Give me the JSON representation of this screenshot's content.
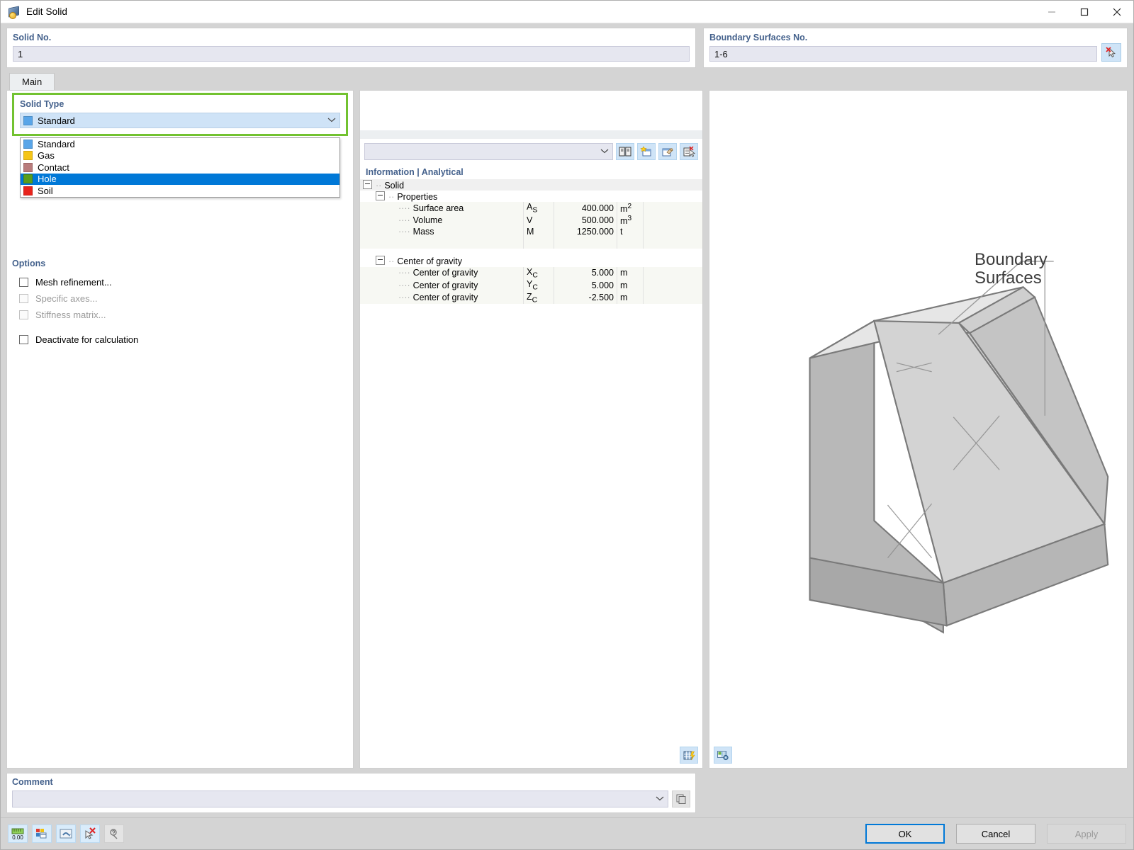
{
  "window": {
    "title": "Edit Solid",
    "icon": "solid-cube-icon",
    "controls": {
      "minimize": "minimize-icon",
      "maximize": "maximize-icon",
      "close": "close-icon"
    }
  },
  "header": {
    "solid_no_label": "Solid No.",
    "solid_no_value": "1",
    "boundary_label": "Boundary Surfaces No.",
    "boundary_value": "1-6",
    "pick_button_icon": "pick-select-icon"
  },
  "tabs": [
    {
      "label": "Main",
      "active": true
    }
  ],
  "solid_type": {
    "group_label": "Solid Type",
    "selected": {
      "label": "Standard",
      "color": "#59a5e8"
    },
    "dropdown_open": true,
    "options": [
      {
        "label": "Standard",
        "color": "#59a5e8",
        "highlighted": false
      },
      {
        "label": "Gas",
        "color": "#f5c518",
        "highlighted": false
      },
      {
        "label": "Contact",
        "color": "#b97c7c",
        "highlighted": false
      },
      {
        "label": "Hole",
        "color": "#5a9e1b",
        "highlighted": true
      },
      {
        "label": "Soil",
        "color": "#e8241c",
        "highlighted": false
      }
    ],
    "highlight_border_color": "#72c230",
    "highlight_row_color": "#0078d7"
  },
  "options": {
    "title": "Options",
    "items": [
      {
        "label": "Mesh refinement...",
        "checked": false,
        "enabled": true
      },
      {
        "label": "Specific axes...",
        "checked": false,
        "enabled": false
      },
      {
        "label": "Stiffness matrix...",
        "checked": false,
        "enabled": false
      },
      {
        "label": "Deactivate for calculation",
        "checked": false,
        "enabled": true
      }
    ]
  },
  "middle": {
    "material_combo_value": "",
    "toolbar_icons": [
      "library-book-icon",
      "new-item-icon",
      "edit-item-icon",
      "delete-item-icon"
    ],
    "info_title": "Information | Analytical",
    "tree": [
      {
        "level": 0,
        "type": "group",
        "label": "Solid"
      },
      {
        "level": 1,
        "type": "group",
        "label": "Properties"
      },
      {
        "level": 2,
        "type": "row",
        "label": "Surface area",
        "symbol": "A",
        "sub": "S",
        "value": "400.000",
        "unit": "m",
        "sup": "2"
      },
      {
        "level": 2,
        "type": "row",
        "label": "Volume",
        "symbol": "V",
        "sub": "",
        "value": "500.000",
        "unit": "m",
        "sup": "3"
      },
      {
        "level": 2,
        "type": "row",
        "label": "Mass",
        "symbol": "M",
        "sub": "",
        "value": "1250.000",
        "unit": "t",
        "sup": ""
      },
      {
        "level": 1,
        "type": "spacer",
        "label": ""
      },
      {
        "level": 1,
        "type": "group",
        "label": "Center of gravity"
      },
      {
        "level": 2,
        "type": "row",
        "label": "Center of gravity",
        "symbol": "X",
        "sub": "C",
        "value": "5.000",
        "unit": "m",
        "sup": ""
      },
      {
        "level": 2,
        "type": "row",
        "label": "Center of gravity",
        "symbol": "Y",
        "sub": "C",
        "value": "5.000",
        "unit": "m",
        "sup": ""
      },
      {
        "level": 2,
        "type": "row",
        "label": "Center of gravity",
        "symbol": "Z",
        "sub": "C",
        "value": "-2.500",
        "unit": "m",
        "sup": ""
      }
    ],
    "footer_icon": "table-calc-icon"
  },
  "view3d": {
    "annotation": "Boundary\nSurfaces",
    "annotation_line1": "Boundary",
    "annotation_line2": "Surfaces",
    "footer_icon": "render-settings-icon"
  },
  "comment": {
    "label": "Comment",
    "value": "",
    "copy_icon": "copy-comment-icon"
  },
  "bottom_toolbar": {
    "icons": [
      "numeric-precision-icon",
      "layout-grid-icon",
      "view-refresh-icon",
      "delete-selection-icon",
      "help-mode-icon"
    ]
  },
  "dialog_buttons": {
    "ok": "OK",
    "cancel": "Cancel",
    "apply": "Apply",
    "apply_enabled": false
  }
}
